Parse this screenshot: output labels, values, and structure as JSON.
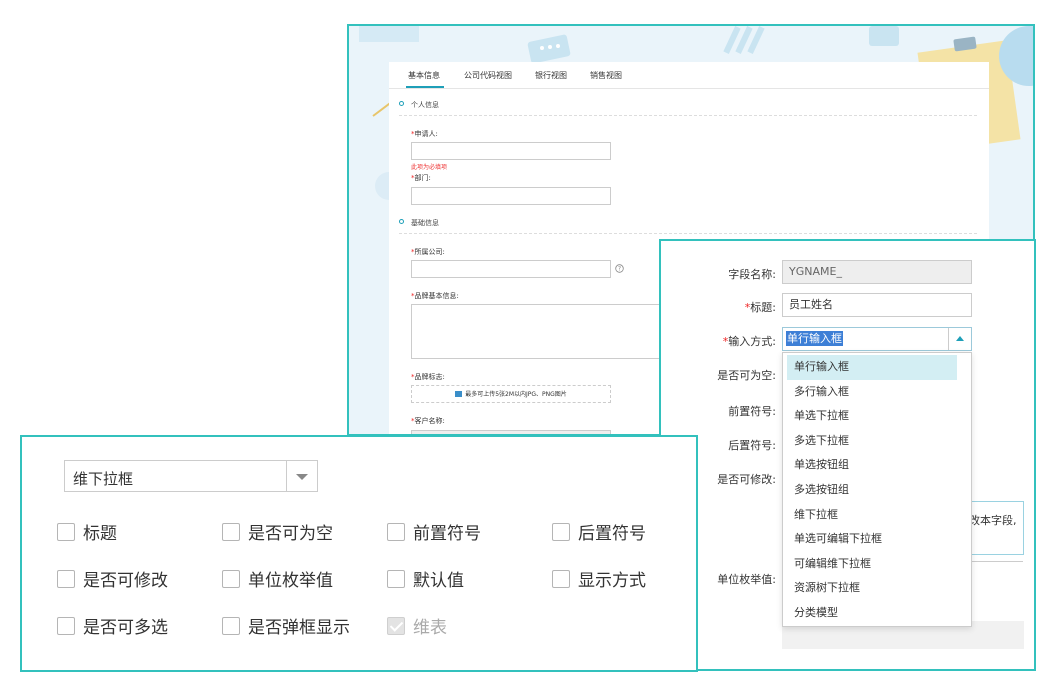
{
  "form": {
    "tabs": [
      "基本信息",
      "公司代码视图",
      "银行视图",
      "销售视图"
    ],
    "section_personal": "个人信息",
    "applicant_label": "申请人:",
    "applicant_error": "此项为必填项",
    "dept_label": "部门:",
    "section_basic": "基础信息",
    "company_label": "所属公司:",
    "brand_info_label": "品牌基本信息:",
    "brand_logo_label": "品牌标志:",
    "upload_hint": "最多可上传5张2M以内JPG、PNG图片",
    "customer_label": "客户名称:",
    "required_mark": "*"
  },
  "field_config": {
    "field_name_label": "字段名称:",
    "field_name_value": "YGNAME_",
    "title_label": "标题:",
    "title_value": "员工姓名",
    "input_mode_label": "输入方式:",
    "input_mode_value": "单行输入框",
    "nullable_label": "是否可为空:",
    "prefix_label": "前置符号:",
    "suffix_label": "后置符号:",
    "editable_label": "是否可修改:",
    "enum_label": "单位枚举值:",
    "hint_fragment": "改本字段,",
    "required_mark": "*",
    "dropdown_options": [
      "单行输入框",
      "多行输入框",
      "单选下拉框",
      "多选下拉框",
      "单选按钮组",
      "多选按钮组",
      "维下拉框",
      "单选可编辑下拉框",
      "可编辑维下拉框",
      "资源树下拉框",
      "分类模型"
    ]
  },
  "checkbox_panel": {
    "select_value": "维下拉框",
    "checkboxes": [
      {
        "label": "标题",
        "checked": false
      },
      {
        "label": "是否可为空",
        "checked": false
      },
      {
        "label": "前置符号",
        "checked": false
      },
      {
        "label": "后置符号",
        "checked": false
      },
      {
        "label": "是否可修改",
        "checked": false
      },
      {
        "label": "单位枚举值",
        "checked": false
      },
      {
        "label": "默认值",
        "checked": false
      },
      {
        "label": "显示方式",
        "checked": false
      },
      {
        "label": "是否可多选",
        "checked": false
      },
      {
        "label": "是否弹框显示",
        "checked": false
      },
      {
        "label": "维表",
        "checked": true
      }
    ]
  },
  "colors": {
    "accent": "#33c1bd",
    "tab_underline": "#1e9fb8",
    "required": "#e22222",
    "highlight": "#d3eef3"
  }
}
